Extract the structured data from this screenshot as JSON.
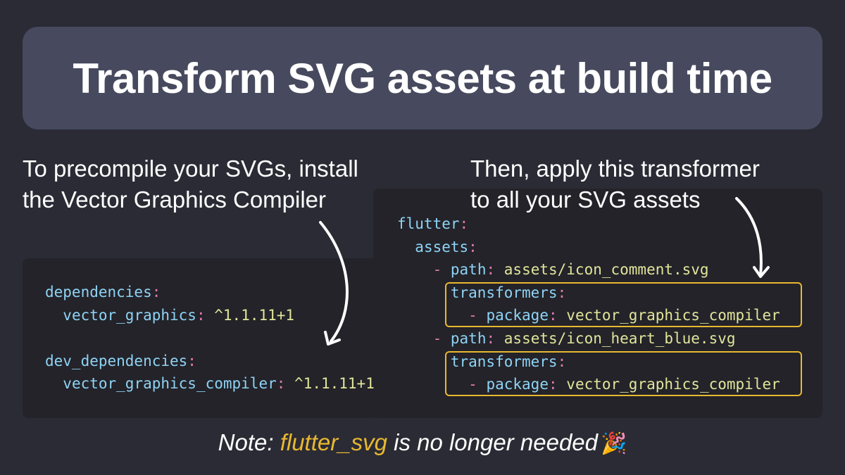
{
  "title": "Transform SVG assets at build time",
  "left_caption": {
    "line1": "To precompile your SVGs, install",
    "line2": "the Vector Graphics Compiler"
  },
  "right_caption": {
    "line1": "Then, apply this transformer",
    "line2": "to all your SVG assets"
  },
  "pubspec_dependencies": {
    "dependencies_key": "dependencies",
    "vector_graphics_key": "vector_graphics",
    "vector_graphics_version": "^1.1.11+1",
    "dev_dependencies_key": "dev_dependencies",
    "compiler_key": "vector_graphics_compiler",
    "compiler_version": "^1.1.11+1"
  },
  "flutter_assets": {
    "flutter_key": "flutter",
    "assets_key": "assets",
    "path_key": "path",
    "transformers_key": "transformers",
    "package_key": "package",
    "entries": [
      {
        "path": "assets/icon_comment.svg",
        "package": "vector_graphics_compiler"
      },
      {
        "path": "assets/icon_heart_blue.svg",
        "package": "vector_graphics_compiler"
      }
    ]
  },
  "note": {
    "prefix": "Note: ",
    "highlight": "flutter_svg",
    "suffix": " is no longer needed",
    "emoji": "🎉"
  },
  "colors": {
    "background": "#2b2b35",
    "title_box": "#474a5e",
    "code_panel": "#232329",
    "yaml_key": "#8fd3f5",
    "yaml_punct": "#e27ab0",
    "yaml_value": "#e2e59b",
    "highlight": "#e8b830"
  },
  "icons": [
    "curved-arrow-icon",
    "party-popper-icon"
  ]
}
